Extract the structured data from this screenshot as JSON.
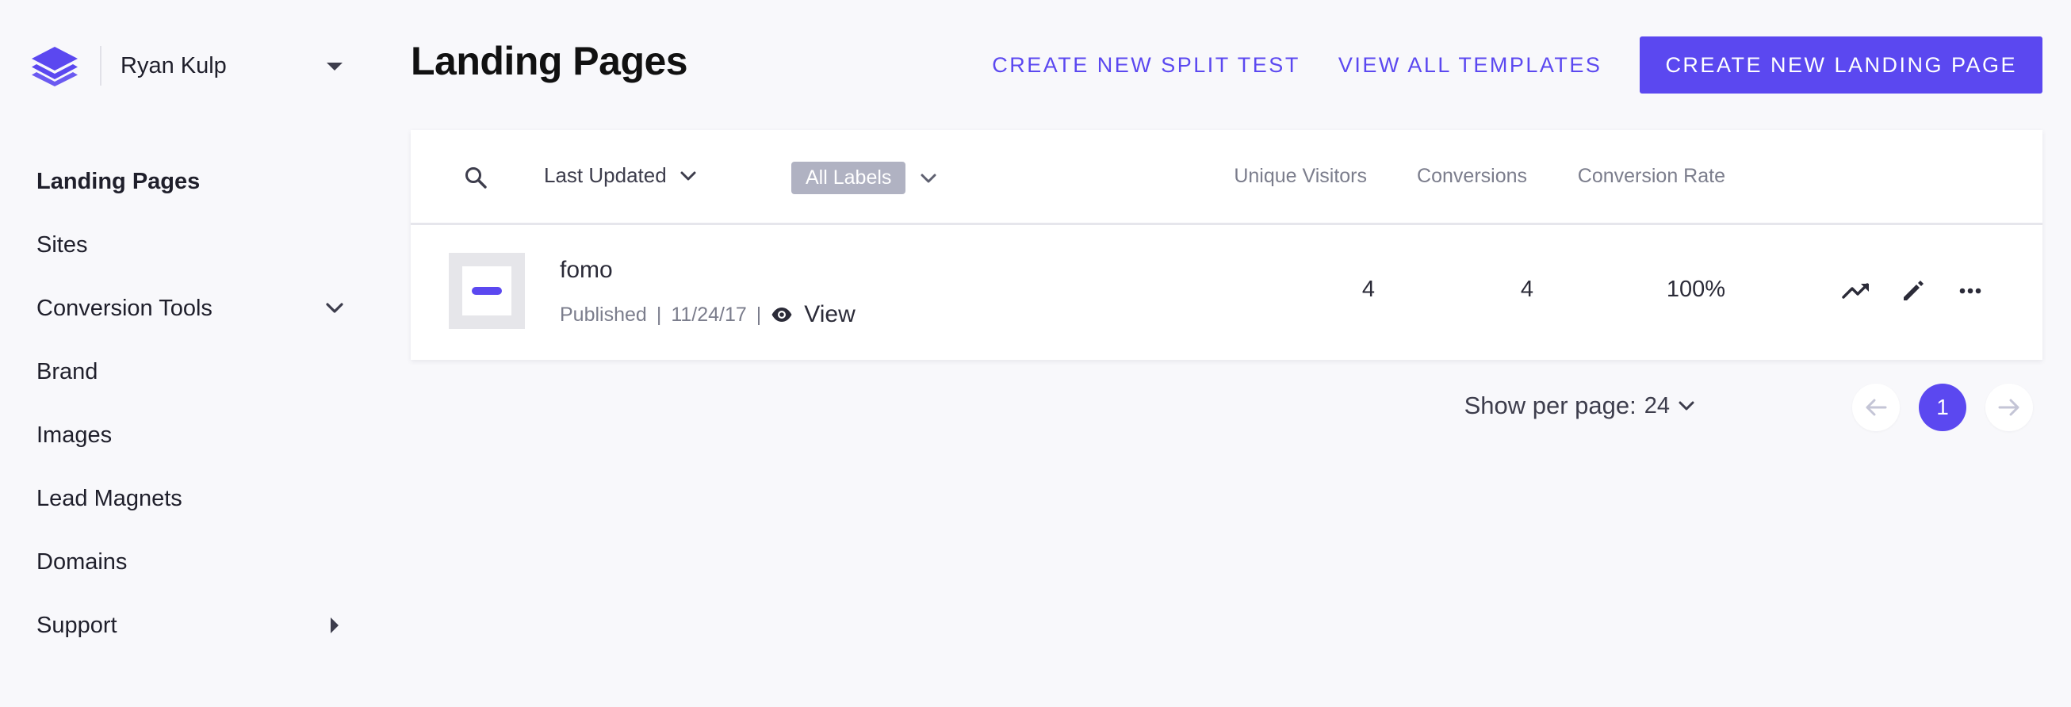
{
  "account": {
    "name": "Ryan Kulp",
    "logo_icon": "layers-logo-icon"
  },
  "nav": {
    "items": [
      {
        "label": "Landing Pages",
        "active": true
      },
      {
        "label": "Sites"
      },
      {
        "label": "Conversion Tools",
        "icon": "chevron-down-icon"
      },
      {
        "label": "Brand"
      },
      {
        "label": "Images"
      },
      {
        "label": "Lead Magnets"
      },
      {
        "label": "Domains"
      },
      {
        "label": "Support",
        "icon": "caret-right-icon"
      }
    ]
  },
  "header": {
    "title": "Landing Pages",
    "split_test_label": "CREATE NEW SPLIT TEST",
    "templates_label": "VIEW ALL TEMPLATES",
    "create_label": "CREATE NEW LANDING PAGE"
  },
  "filters": {
    "sort_label": "Last Updated",
    "labels_chip": "All Labels"
  },
  "columns": {
    "unique_visitors": "Unique Visitors",
    "conversions": "Conversions",
    "conversion_rate": "Conversion Rate"
  },
  "rows": [
    {
      "name": "fomo",
      "status": "Published",
      "date": "11/24/17",
      "view_label": "View",
      "unique_visitors": "4",
      "conversions": "4",
      "conversion_rate": "100%"
    }
  ],
  "pagination": {
    "per_page_label": "Show per page:",
    "per_page_value": "24",
    "current_page": "1"
  },
  "colors": {
    "accent": "#5b48f0",
    "background": "#f8f8fb",
    "chip": "#b0b2c2"
  }
}
